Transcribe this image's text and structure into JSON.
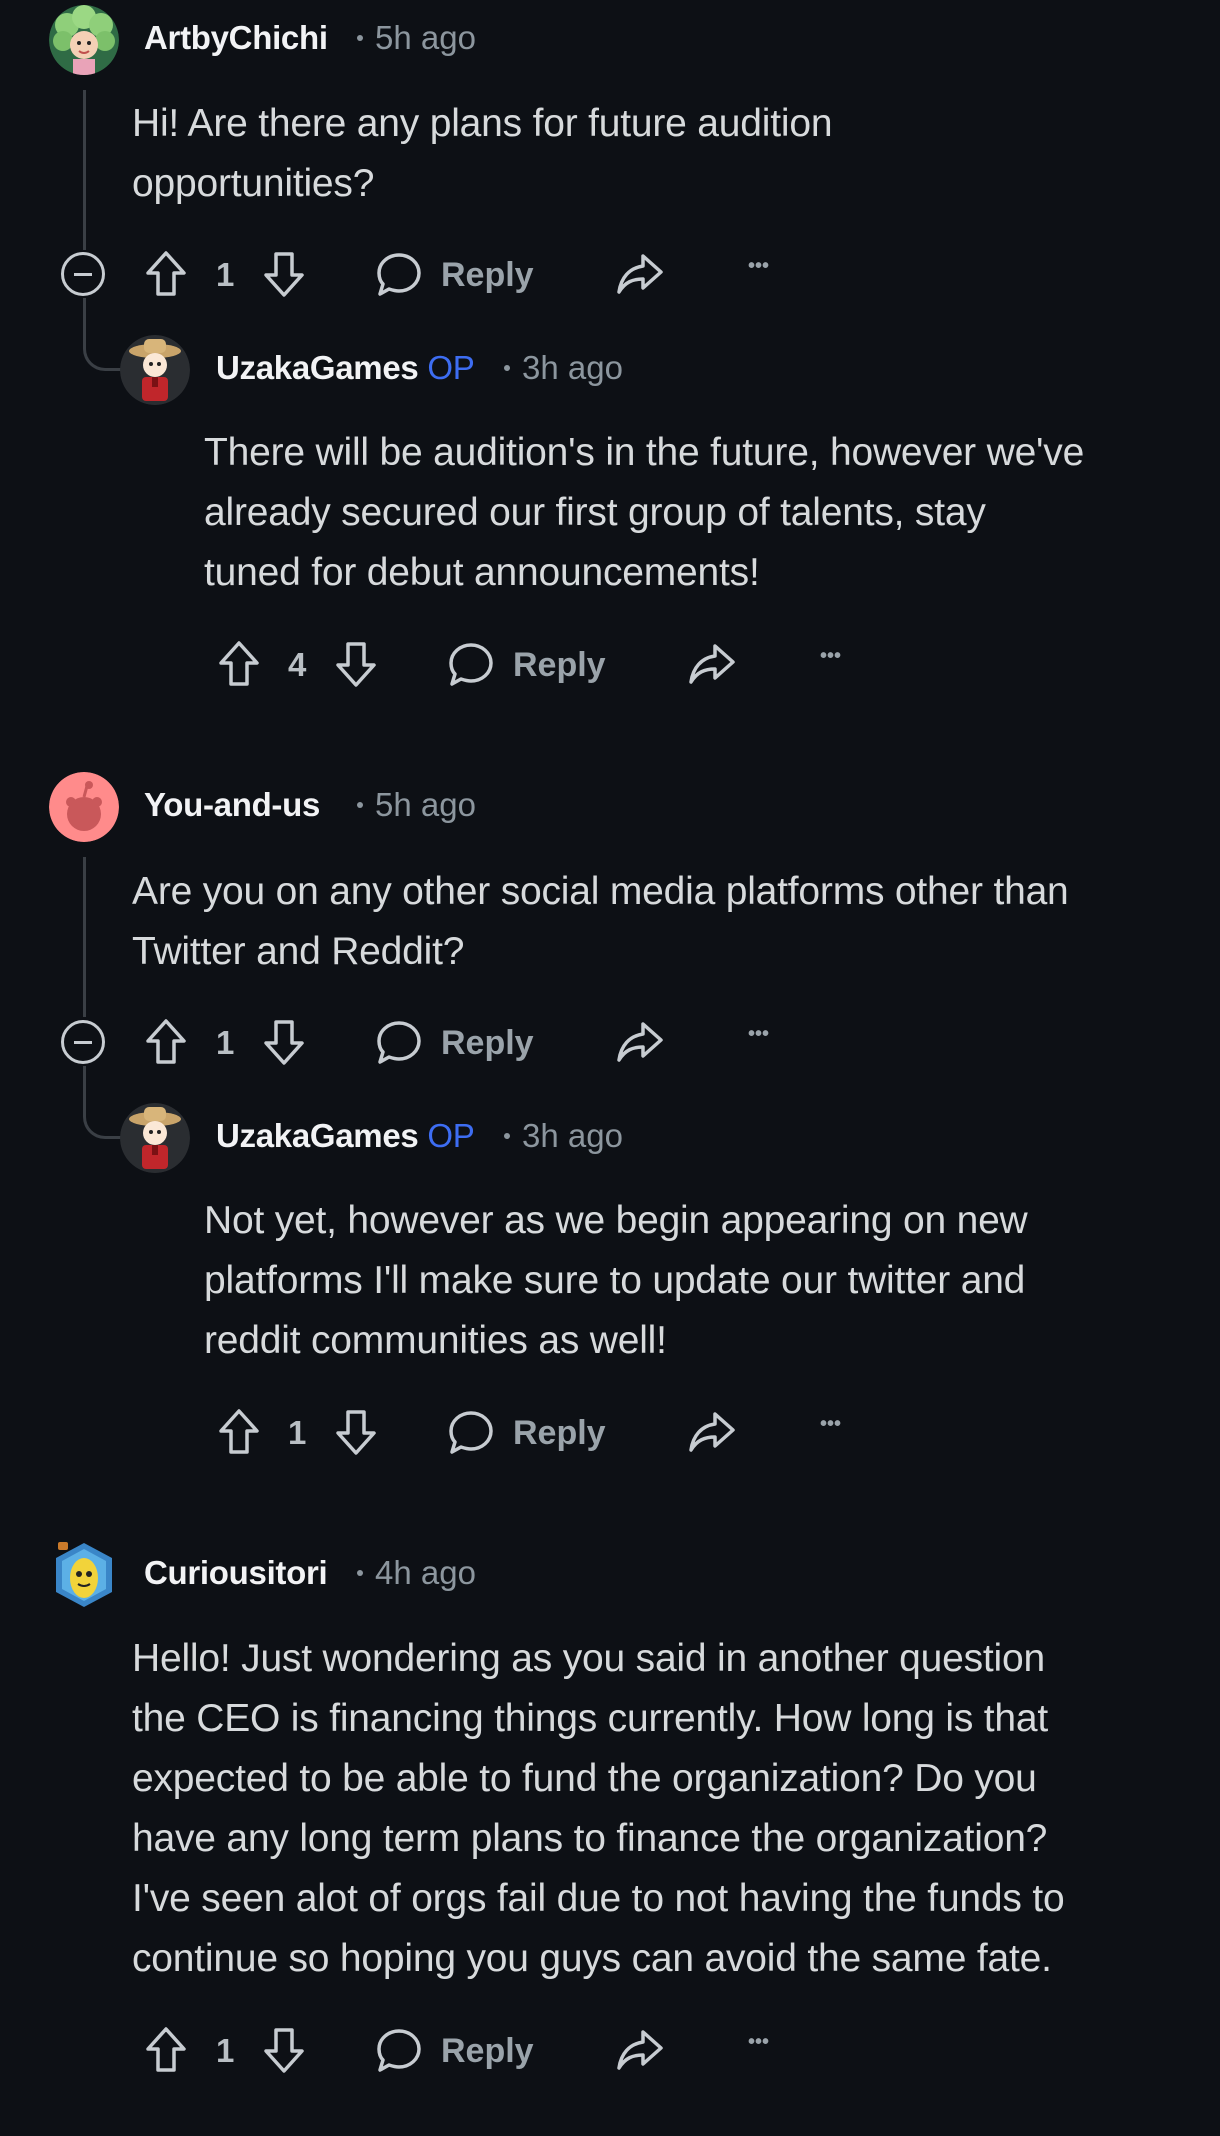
{
  "comments": [
    {
      "username": "ArtbyChichi",
      "time": "5h ago",
      "body_lines": [
        "Hi! Are there any plans for future audition",
        "opportunities?"
      ],
      "votes": "1",
      "reply_label": "Reply",
      "avatar_icon": "green-hair-avatar-icon"
    },
    {
      "username": "UzakaGames",
      "op_badge": "OP",
      "time": "3h ago",
      "body_lines": [
        "There will be audition's in the future, however we've",
        "already secured our first group of talents, stay",
        "tuned for debut announcements!"
      ],
      "votes": "4",
      "reply_label": "Reply",
      "avatar_icon": "cowboy-avatar-icon"
    },
    {
      "username": "You-and-us",
      "time": "5h ago",
      "body_lines": [
        "Are you on any other social media platforms other than",
        "Twitter and Reddit?"
      ],
      "votes": "1",
      "reply_label": "Reply",
      "avatar_icon": "default-snoo-avatar-icon"
    },
    {
      "username": "UzakaGames",
      "op_badge": "OP",
      "time": "3h ago",
      "body_lines": [
        "Not yet, however as we begin appearing on new",
        "platforms I'll make sure to update our twitter and",
        "reddit communities as well!"
      ],
      "votes": "1",
      "reply_label": "Reply",
      "avatar_icon": "cowboy-avatar-icon"
    },
    {
      "username": "Curiousitori",
      "time": "4h ago",
      "body_lines": [
        "Hello! Just wondering as you said in another question",
        "the CEO is financing things currently. How long is that",
        "expected to be able to fund the organization? Do you",
        "have any long term plans to finance the organization?",
        "I've seen alot of orgs fail due to not having the funds to",
        "continue so hoping you guys can avoid the same fate."
      ],
      "votes": "1",
      "reply_label": "Reply",
      "avatar_icon": "banana-avatar-icon"
    }
  ],
  "more_label": "•••",
  "colors": {
    "background": "#0d1015",
    "op_badge": "#3d6df2",
    "text": "#d7dadc",
    "muted": "#8c969e"
  }
}
